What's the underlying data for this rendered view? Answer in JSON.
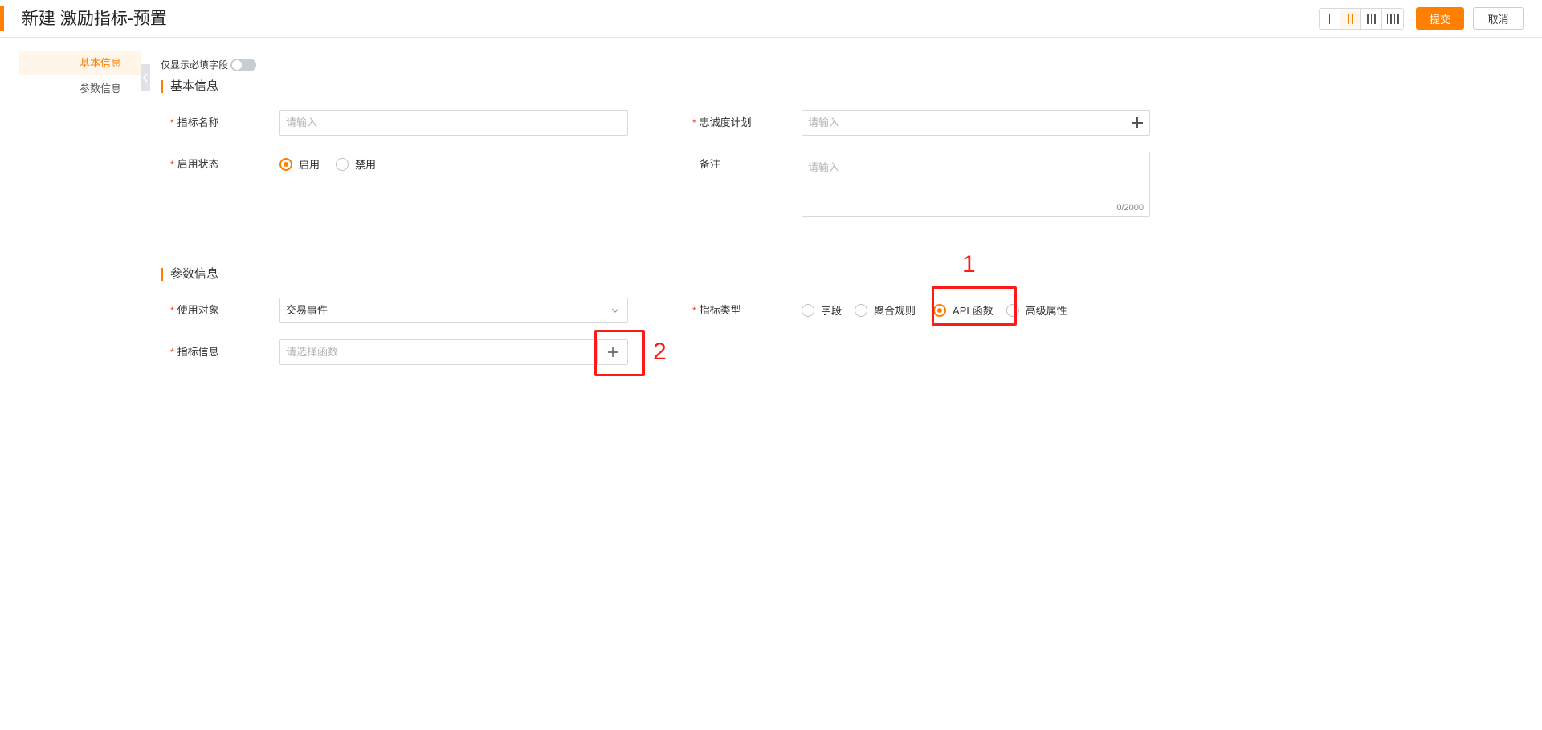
{
  "header": {
    "title": "新建 激励指标-预置",
    "submit_label": "提交",
    "cancel_label": "取消",
    "accent_color": "#ff8000"
  },
  "sidebar": {
    "items": [
      {
        "label": "基本信息",
        "active": true
      },
      {
        "label": "参数信息",
        "active": false
      }
    ]
  },
  "form": {
    "required_only_label": "仅显示必填字段",
    "basic_section": {
      "title": "基本信息",
      "metric_name_label": "指标名称",
      "metric_name_placeholder": "请输入",
      "loyalty_plan_label": "忠诚度计划",
      "loyalty_plan_placeholder": "请输入",
      "status_label": "启用状态",
      "status_options": [
        "启用",
        "禁用"
      ],
      "status_selected": "启用",
      "remark_label": "备注",
      "remark_placeholder": "请输入",
      "remark_counter": "0/2000"
    },
    "param_section": {
      "title": "参数信息",
      "target_label": "使用对象",
      "target_value": "交易事件",
      "metric_type_label": "指标类型",
      "metric_type_options": [
        "字段",
        "聚合规则",
        "APL函数",
        "高级属性"
      ],
      "metric_type_selected": "APL函数",
      "metric_info_label": "指标信息",
      "metric_info_placeholder": "请选择函数"
    }
  },
  "annotations": {
    "label_1": "1",
    "label_2": "2",
    "color": "#ff1a1a"
  }
}
